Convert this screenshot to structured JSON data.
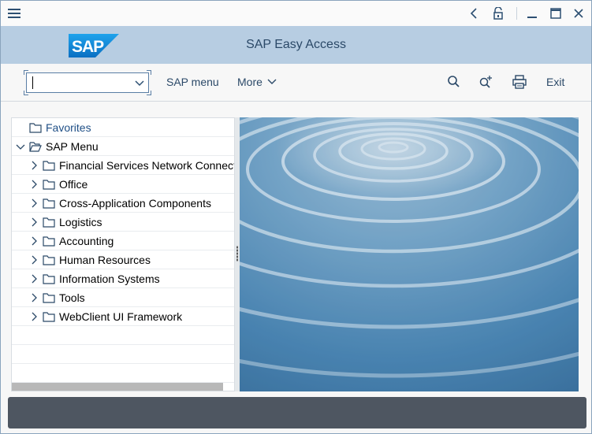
{
  "titlebar": {
    "controls": [
      "back-icon",
      "lock-icon",
      "minimize-icon",
      "maximize-icon",
      "close-icon"
    ]
  },
  "header": {
    "logo_text": "SAP",
    "title": "SAP Easy Access",
    "color": "#b7cde2"
  },
  "toolbar": {
    "command_value": "",
    "sap_menu_label": "SAP menu",
    "more_label": "More",
    "exit_label": "Exit",
    "icons": [
      "search-icon",
      "search-plus-icon",
      "print-icon"
    ]
  },
  "tree": {
    "favorites": "Favorites",
    "sap_menu": "SAP Menu",
    "items": [
      {
        "label": "Financial Services Network Connect"
      },
      {
        "label": "Office"
      },
      {
        "label": "Cross-Application Components"
      },
      {
        "label": "Logistics"
      },
      {
        "label": "Accounting"
      },
      {
        "label": "Human Resources"
      },
      {
        "label": "Information Systems"
      },
      {
        "label": "Tools"
      },
      {
        "label": "WebClient UI Framework"
      }
    ]
  },
  "footer": {
    "status": ""
  },
  "colors": {
    "accent": "#2b4968",
    "footer": "#4e5661",
    "logo": "#1a7fd0"
  }
}
